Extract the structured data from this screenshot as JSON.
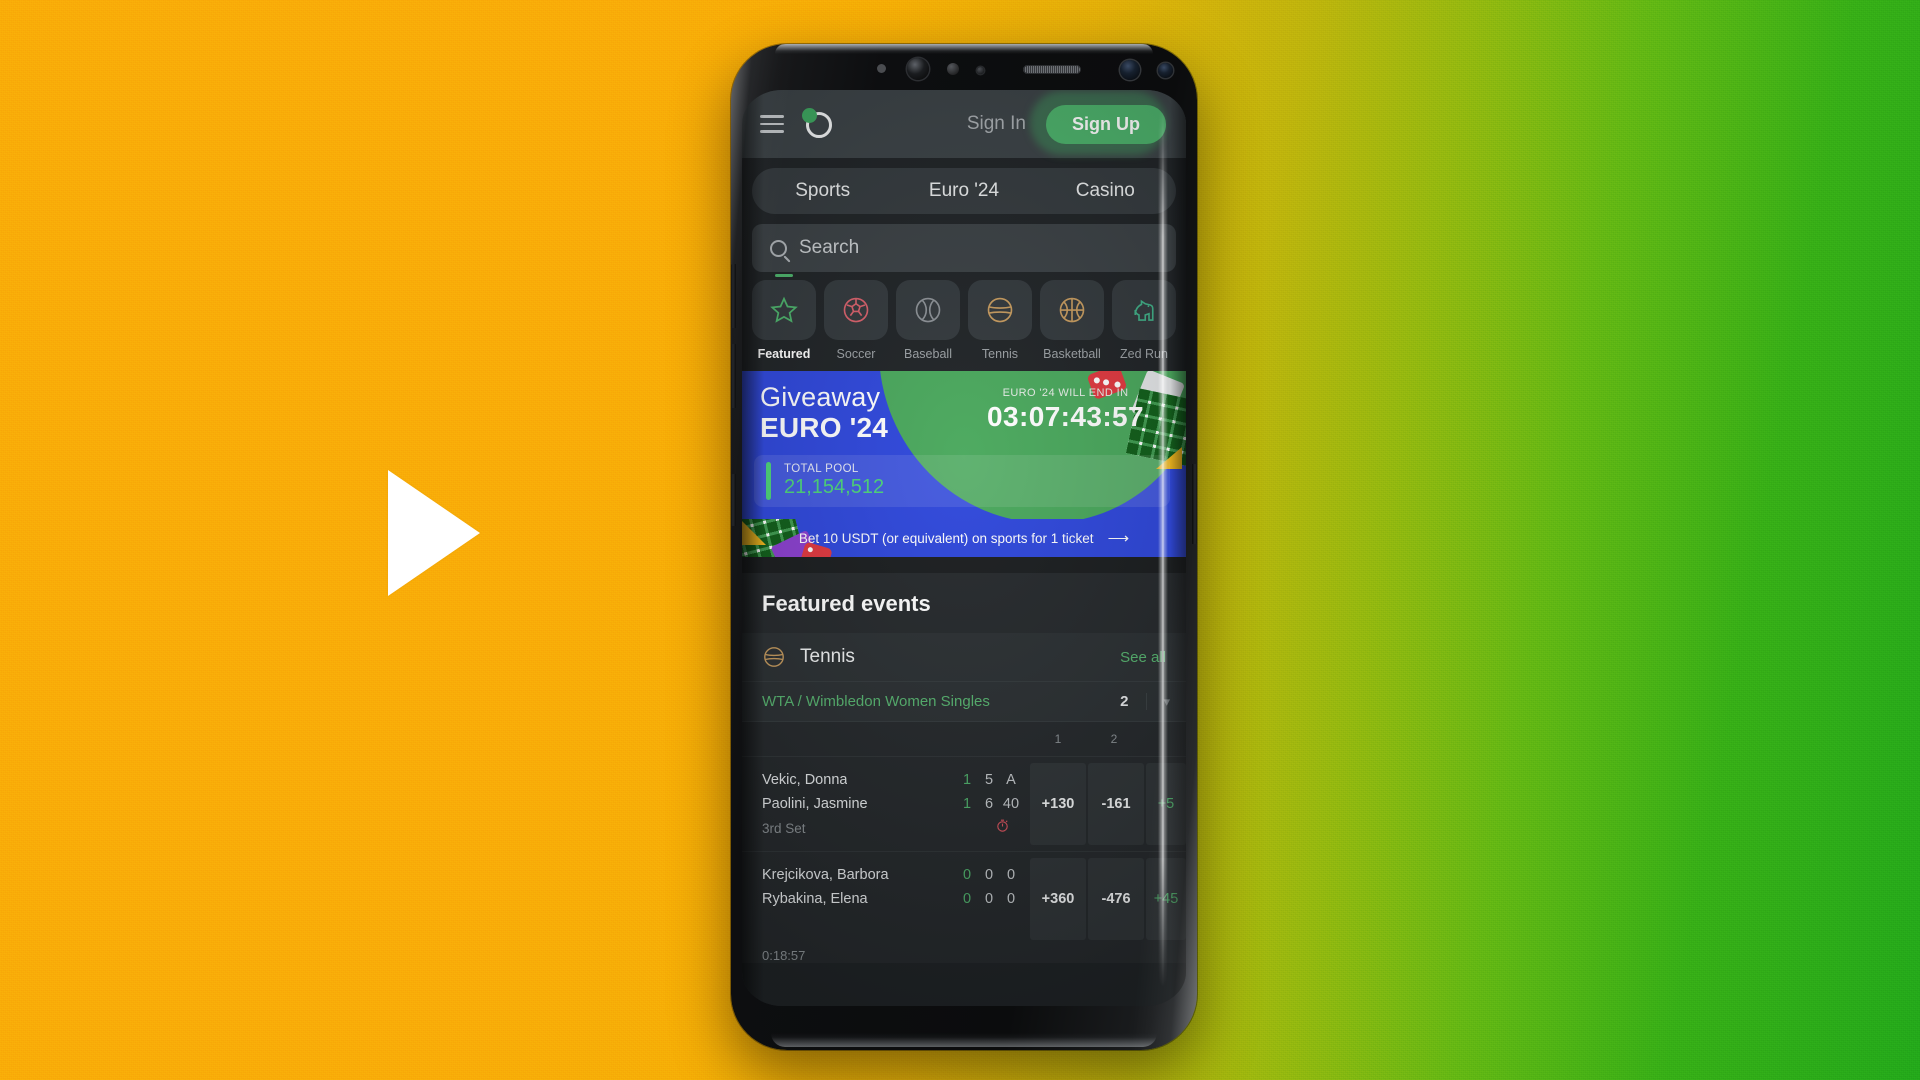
{
  "background": {
    "gradient_from": "#F9AC08",
    "gradient_to": "#23A81A",
    "play_button": "play-triangle"
  },
  "app": {
    "header": {
      "menu_icon": "hamburger-menu-icon",
      "logo_icon": "brand-logo-icon",
      "sign_in_label": "Sign In",
      "sign_up_label": "Sign Up",
      "accent_green": "#4CB26B"
    },
    "nav_tabs": [
      {
        "label": "Sports"
      },
      {
        "label": "Euro '24"
      },
      {
        "label": "Casino"
      }
    ],
    "search": {
      "placeholder": "Search",
      "icon": "search-icon"
    },
    "categories": [
      {
        "label": "Featured",
        "icon": "star-icon",
        "color": "#4CB26B",
        "active": true
      },
      {
        "label": "Soccer",
        "icon": "soccer-ball-icon",
        "color": "#D9606B",
        "active": false
      },
      {
        "label": "Baseball",
        "icon": "baseball-icon",
        "color": "#8C9196",
        "active": false
      },
      {
        "label": "Tennis",
        "icon": "tennis-ball-icon",
        "color": "#C79B5E",
        "active": false
      },
      {
        "label": "Basketball",
        "icon": "basketball-icon",
        "color": "#C79B5E",
        "active": false
      },
      {
        "label": "Zed Run",
        "icon": "horse-icon",
        "color": "#3FAE86",
        "active": false
      }
    ],
    "banner": {
      "title_line1": "Giveaway",
      "title_line2": "EURO '24",
      "countdown_label": "EURO '24 WILL END IN",
      "countdown_value": "03:07:43:57",
      "pool_label": "TOTAL POOL",
      "pool_value": "21,154,512",
      "pool_value_color": "#4CD47A",
      "cta_text": "Bet 10 USDT (or equivalent) on sports for 1 ticket",
      "cta_arrow": "arrow-right-icon",
      "bg_color": "#2E47DC",
      "blob_color": "#49A85C"
    },
    "featured": {
      "title": "Featured events",
      "sport": {
        "icon": "tennis-ball-icon",
        "name": "Tennis",
        "see_all_label": "See all"
      },
      "league": {
        "org": "WTA",
        "separator": "/",
        "name": "Wimbledon Women Singles",
        "count": "2",
        "chevron": "chevron-down-icon"
      },
      "columns": [
        "1",
        "2"
      ],
      "matches": [
        {
          "player1": "Vekic, Donna",
          "player1_scores": [
            "1",
            "5",
            "A"
          ],
          "player2": "Paolini, Jasmine",
          "player2_scores": [
            "1",
            "6",
            "40"
          ],
          "status": "3rd Set",
          "status_icon": "timer-icon",
          "odds": [
            "+130",
            "-161",
            "+5"
          ]
        },
        {
          "player1": "Krejcikova, Barbora",
          "player1_scores": [
            "0",
            "0",
            "0"
          ],
          "player2": "Rybakina, Elena",
          "player2_scores": [
            "0",
            "0",
            "0"
          ],
          "status": "",
          "status_icon": "",
          "odds": [
            "+360",
            "-476",
            "+45"
          ]
        }
      ],
      "last_time": "0:18:57"
    }
  }
}
